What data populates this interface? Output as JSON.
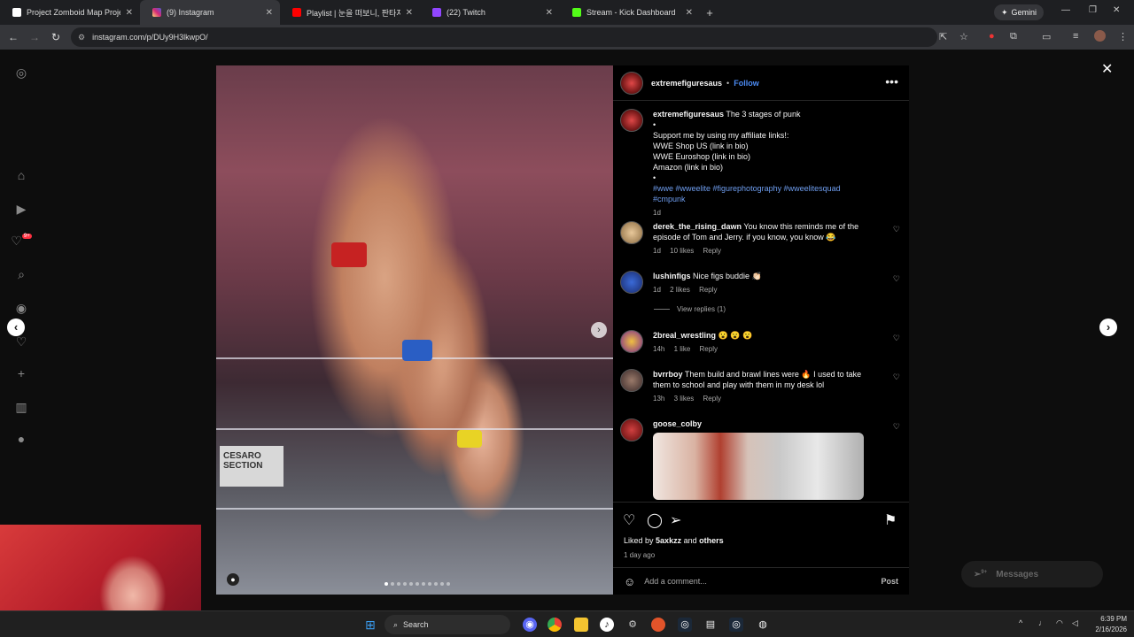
{
  "browser": {
    "tabs": [
      {
        "label": "Project Zomboid Map Project",
        "color": "#ffffff"
      },
      {
        "label": "(9) Instagram",
        "color": "#d62976"
      },
      {
        "label": "Playlist | 눈을 떠보니, 판타지 소",
        "color": "#ff0000"
      },
      {
        "label": "(22) Twitch",
        "color": "#9146ff"
      },
      {
        "label": "Stream - Kick Dashboard",
        "color": "#53fc18"
      }
    ],
    "gemini_label": "Gemini",
    "url": "instagram.com/p/DUy9H3lkwpO/"
  },
  "post": {
    "author": "extremefiguresaus",
    "follow_label": "Follow",
    "caption_title": "The 3 stages of punk",
    "caption_lines": [
      "•",
      "Support me by using my affiliate links!:",
      "WWE Shop US (link in bio)",
      "WWE Euroshop (link in bio)",
      "Amazon (link in bio)",
      "•"
    ],
    "hashtags": "#wwe #wweelite #figurephotography #wweelitesquad #cmpunk",
    "caption_age": "1d",
    "photo_sign": "CESARO SECTION",
    "comments": [
      {
        "user": "derek_the_rising_dawn",
        "text": "You know this reminds me of the episode of Tom and Jerry. if you know, you know 😂",
        "age": "1d",
        "likes": "10 likes",
        "reply": "Reply"
      },
      {
        "user": "lushinfigs",
        "text": "Nice figs buddie 👏🏻",
        "age": "1d",
        "likes": "2 likes",
        "reply": "Reply",
        "view_replies": "View replies (1)"
      },
      {
        "user": "2breal_wrestling",
        "text": "😮 😮 😮",
        "age": "14h",
        "likes": "1 like",
        "reply": "Reply"
      },
      {
        "user": "bvrrboy",
        "text": "Them build and brawl lines were 🔥 I used to take them to school and play with them in my desk lol",
        "age": "13h",
        "likes": "3 likes",
        "reply": "Reply"
      },
      {
        "user": "goose_colby",
        "text": ""
      }
    ],
    "liked_prefix": "Liked by",
    "liked_user": "5axkzz",
    "liked_and": "and",
    "liked_others": "others",
    "post_age": "1 day ago",
    "add_comment_placeholder": "Add a comment...",
    "post_button": "Post"
  },
  "messages_label": "Messages",
  "messages_badge": "9+",
  "notif_badge": "9+",
  "taskbar": {
    "search_label": "Search",
    "time": "6:39 PM",
    "date": "2/16/2026"
  }
}
